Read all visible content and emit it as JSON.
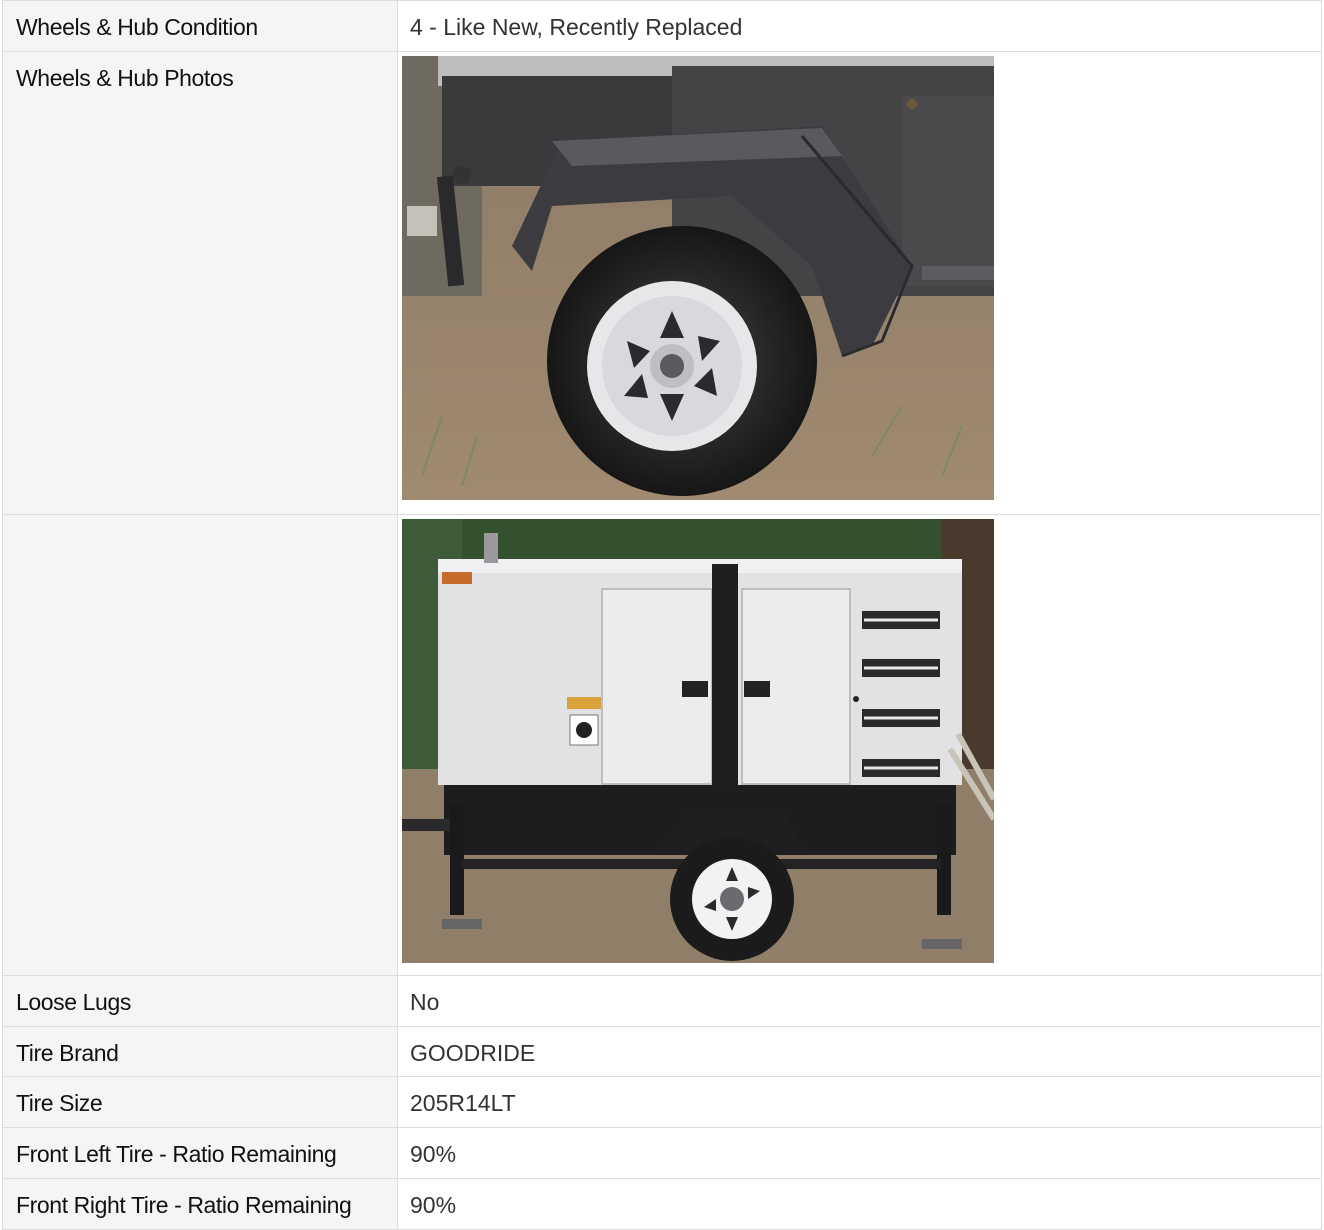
{
  "rows": [
    {
      "label": "Wheels & Hub Condition",
      "value": "4 - Like New, Recently Replaced"
    },
    {
      "label": "Wheels & Hub Photos",
      "photo": "trailer-wheel-photo"
    },
    {
      "label": "",
      "photo": "generator-trailer-photo"
    },
    {
      "label": "Loose Lugs",
      "value": "No"
    },
    {
      "label": "Tire Brand",
      "value": "GOODRIDE"
    },
    {
      "label": "Tire Size",
      "value": "205R14LT"
    },
    {
      "label": "Front Left Tire - Ratio Remaining",
      "value": "90%"
    },
    {
      "label": "Front Right Tire - Ratio Remaining",
      "value": "90%"
    }
  ],
  "colors": {
    "label_background": "#f5f5f5",
    "border": "#dcdcdc",
    "label_text": "#111111",
    "value_text": "#333333"
  }
}
